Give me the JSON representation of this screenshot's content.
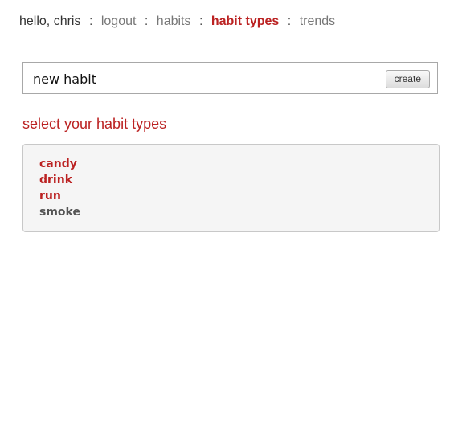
{
  "nav": {
    "greeting": "hello, chris",
    "separator": ":",
    "links": {
      "logout": "logout",
      "habits": "habits",
      "habit_types": "habit types",
      "trends": "trends"
    }
  },
  "new_habit": {
    "value": "new habit",
    "button_label": "create"
  },
  "section": {
    "title": "select your habit types"
  },
  "habit_types": [
    {
      "label": "candy",
      "selected": true
    },
    {
      "label": "drink",
      "selected": true
    },
    {
      "label": "run",
      "selected": true
    },
    {
      "label": "smoke",
      "selected": false
    }
  ],
  "colors": {
    "accent": "#bb2222",
    "unselected": "#555555",
    "panel_bg": "#f5f5f5"
  }
}
